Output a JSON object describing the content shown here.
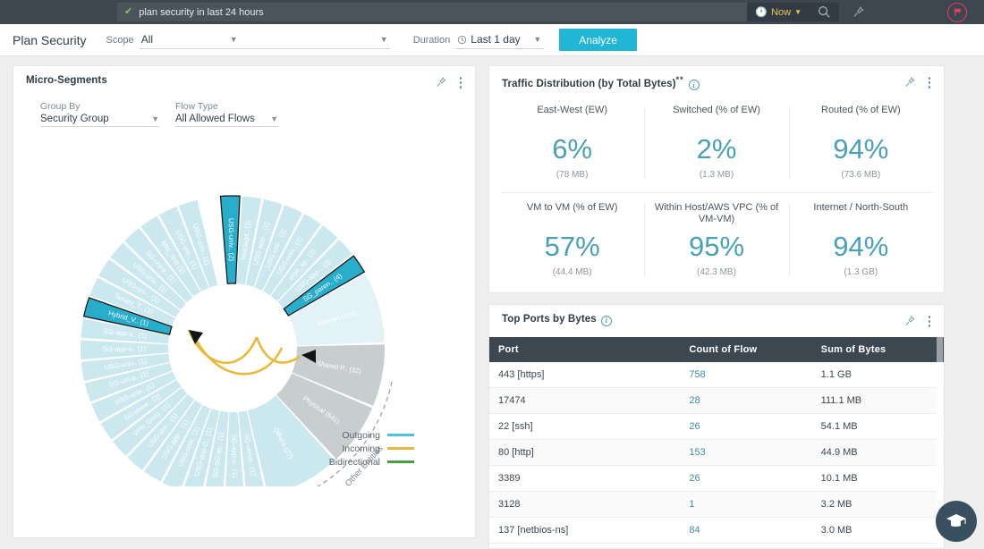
{
  "topbar": {
    "search_value": "plan security in last 24 hours",
    "check_icon": "check-icon",
    "time_button": "Now",
    "clock_icon": "clock-icon",
    "caret_icon": "chevron-down-icon",
    "search_icon": "search-icon",
    "pin_icon": "pin-icon",
    "flag_icon": "flag-icon"
  },
  "actionbar": {
    "title": "Plan Security",
    "scope_label": "Scope",
    "scope_value": "All",
    "scope_secondary_value": "",
    "duration_label": "Duration",
    "duration_value": "Last 1 day",
    "analyze_label": "Analyze"
  },
  "micro_segments": {
    "title": "Micro-Segments",
    "pin_icon": "pin-icon",
    "menu_icon": "kebab-menu-icon",
    "group_by_label": "Group By",
    "group_by_value": "Security Group",
    "flow_type_label": "Flow Type",
    "flow_type_value": "All Allowed Flows",
    "legend": [
      {
        "label": "Outgoing",
        "color": "#4cc3e0"
      },
      {
        "label": "Incoming",
        "color": "#e8b93a"
      },
      {
        "label": "Bidirectional",
        "color": "#4d9d45"
      }
    ],
    "other_entities_label": "Other Entities",
    "segments": [
      {
        "label": "USG-univ.. (2)",
        "highlight": true
      },
      {
        "label": "TestJagd.. (2)",
        "highlight": false
      },
      {
        "label": "USG-app-.. (2)",
        "highlight": false
      },
      {
        "label": "USG-uni-.. (2)",
        "highlight": false
      },
      {
        "label": "USG-univ.. (2)",
        "highlight": false
      },
      {
        "label": "arpit_sg.. (2)",
        "highlight": false
      },
      {
        "label": "USG-app-.. (3)",
        "highlight": false
      },
      {
        "label": "SG_paren.. (4)",
        "highlight": true
      },
      {
        "label": "Internet (313)",
        "highlight": false,
        "kind": "internet"
      },
      {
        "label": "Shared P.. (32)",
        "highlight": false,
        "kind": "other"
      },
      {
        "label": "Physical (641)",
        "highlight": false,
        "kind": "other"
      },
      {
        "label": "Others (27)",
        "highlight": false
      },
      {
        "label": "SG-unive.. (1)",
        "highlight": false
      },
      {
        "label": "SG-app-u.. (1)",
        "highlight": false
      },
      {
        "label": "SG-SG-ap.. (1)",
        "highlight": false
      },
      {
        "label": "USG-app-O.. (1)",
        "highlight": false
      },
      {
        "label": "USG-univ.. (1)",
        "highlight": false
      },
      {
        "label": "USG-app-.. (1)",
        "highlight": false
      },
      {
        "label": "USG-uni-.. (1)",
        "highlight": false
      },
      {
        "label": "VPN_Grou.. (1)",
        "highlight": false
      },
      {
        "label": "SG-unive.. (1)",
        "highlight": false
      },
      {
        "label": "USG-univ.. (1)",
        "highlight": false
      },
      {
        "label": "SG-uni-a.. (1)",
        "highlight": false
      },
      {
        "label": "USG-univ.. (1)",
        "highlight": false
      },
      {
        "label": "SG-app-u.. (1)",
        "highlight": false
      },
      {
        "label": "SG-app-u.. (1)",
        "highlight": false
      },
      {
        "label": "Hybrid_V.. (1)",
        "highlight": true
      },
      {
        "label": "Tenant_T.. (1)",
        "highlight": false
      },
      {
        "label": "USG-uni-.. (1)",
        "highlight": false
      },
      {
        "label": "USG-univ.. (1)",
        "highlight": false
      },
      {
        "label": "SG-uni-a.. (1)",
        "highlight": false
      },
      {
        "label": "MM_Test (1)",
        "highlight": false
      },
      {
        "label": "USG-uni-.. (1)",
        "highlight": false
      },
      {
        "label": "USG-univ.. (1)",
        "highlight": false
      }
    ]
  },
  "traffic_distribution": {
    "title": "Traffic Distribution (by Total Bytes)",
    "title_sup": "**",
    "info_icon": "info-icon",
    "pin_icon": "pin-icon",
    "menu_icon": "kebab-menu-icon",
    "metrics": [
      {
        "name": "East-West (EW)",
        "value": "6%",
        "sub": "(78 MB)"
      },
      {
        "name": "Switched (% of EW)",
        "value": "2%",
        "sub": "(1.3 MB)"
      },
      {
        "name": "Routed (% of EW)",
        "value": "94%",
        "sub": "(73.6 MB)"
      },
      {
        "name": "VM to VM (% of EW)",
        "value": "57%",
        "sub": "(44.4 MB)"
      },
      {
        "name": "Within Host/AWS VPC (% of VM-VM)",
        "value": "95%",
        "sub": "(42.3 MB)"
      },
      {
        "name": "Internet / North-South",
        "value": "94%",
        "sub": "(1.3 GB)"
      }
    ]
  },
  "top_ports": {
    "title": "Top Ports by Bytes",
    "info_icon": "info-icon",
    "pin_icon": "pin-icon",
    "menu_icon": "kebab-menu-icon",
    "columns": [
      "Port",
      "Count of Flow",
      "Sum of Bytes"
    ],
    "rows": [
      {
        "port": "443 [https]",
        "count": "758",
        "bytes": "1.1 GB"
      },
      {
        "port": "17474",
        "count": "28",
        "bytes": "111.1 MB"
      },
      {
        "port": "22 [ssh]",
        "count": "26",
        "bytes": "54.1 MB"
      },
      {
        "port": "80 [http]",
        "count": "153",
        "bytes": "44.9 MB"
      },
      {
        "port": "3389",
        "count": "26",
        "bytes": "10.1 MB"
      },
      {
        "port": "3128",
        "count": "1",
        "bytes": "3.2 MB"
      },
      {
        "port": "137 [netbios-ns]",
        "count": "84",
        "bytes": "3.0 MB"
      }
    ]
  },
  "help_fab": {
    "icon": "graduation-cap-icon"
  },
  "colors": {
    "accent": "#21b5d6",
    "header_dark": "#3d474f",
    "metric_blue": "#49a0b8",
    "segment_light": "#cbe8ef",
    "segment_highlight": "#28aecb"
  }
}
